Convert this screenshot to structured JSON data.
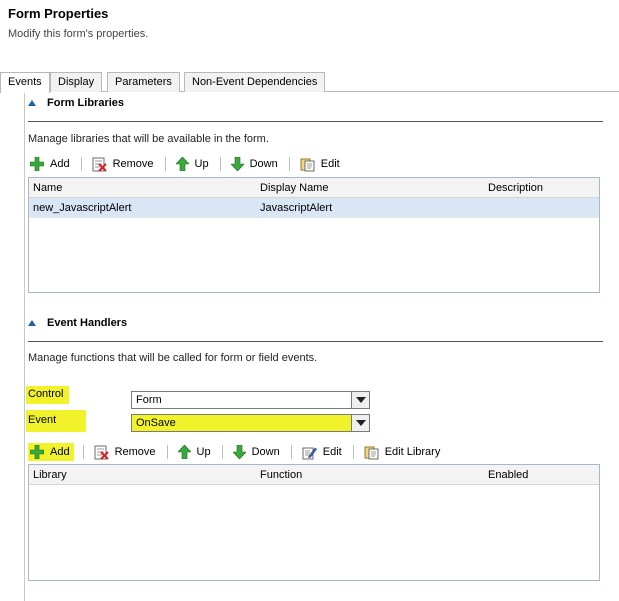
{
  "header": {
    "title": "Form Properties",
    "subtitle": "Modify this form's properties."
  },
  "tabs": [
    {
      "label": "Events",
      "active": true
    },
    {
      "label": "Display",
      "active": false
    },
    {
      "label": "Parameters",
      "active": false
    },
    {
      "label": "Non-Event Dependencies",
      "active": false
    }
  ],
  "form_libraries": {
    "heading": "Form Libraries",
    "description": "Manage libraries that will be available in the form.",
    "toolbar": {
      "add": "Add",
      "remove": "Remove",
      "up": "Up",
      "down": "Down",
      "edit": "Edit"
    },
    "columns": [
      "Name",
      "Display Name",
      "Description"
    ],
    "rows": [
      {
        "name": "new_JavascriptAlert",
        "display_name": "JavascriptAlert",
        "description": ""
      }
    ]
  },
  "event_handlers": {
    "heading": "Event Handlers",
    "description": "Manage functions that will be called for form or field events.",
    "control_label": "Control",
    "control_value": "Form",
    "event_label": "Event",
    "event_value": "OnSave",
    "toolbar": {
      "add": "Add",
      "remove": "Remove",
      "up": "Up",
      "down": "Down",
      "edit": "Edit",
      "edit_library": "Edit Library"
    },
    "columns": [
      "Library",
      "Function",
      "Enabled"
    ]
  },
  "colors": {
    "highlight": "#f2f22a",
    "selected_row": "#d9e6f5",
    "accent": "#1f5fa8"
  }
}
